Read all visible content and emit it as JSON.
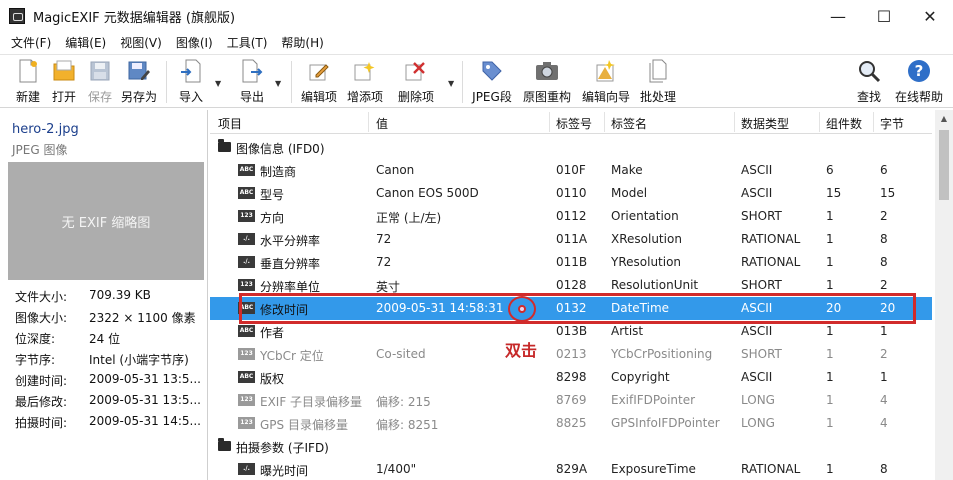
{
  "window": {
    "title": "MagicEXIF 元数据编辑器 (旗舰版)",
    "controls": [
      "—",
      "☐",
      "✕"
    ]
  },
  "menu": [
    "文件(F)",
    "编辑(E)",
    "视图(V)",
    "图像(I)",
    "工具(T)",
    "帮助(H)"
  ],
  "toolbar": {
    "new": "新建",
    "open": "打开",
    "save": "保存",
    "save_as": "另存为",
    "import": "导入",
    "export": "导出",
    "edit_item": "编辑项",
    "add_item": "增添项",
    "delete_item": "删除项",
    "jpeg_segment": "JPEG段",
    "rebuild": "原图重构",
    "wizard": "编辑向导",
    "batch": "批处理",
    "find": "查找",
    "help": "在线帮助"
  },
  "file": {
    "name": "hero-2.jpg",
    "type": "JPEG 图像",
    "thumb_text": "无 EXIF 缩略图",
    "info": [
      {
        "label": "文件大小:",
        "value": "709.39 KB"
      },
      {
        "label": "图像大小:",
        "value": "2322 × 1100 像素"
      },
      {
        "label": "位深度:",
        "value": "24 位"
      },
      {
        "label": "字节序:",
        "value": "Intel (小端字节序)"
      },
      {
        "label": "创建时间:",
        "value": "2009-05-31 13:5..."
      },
      {
        "label": "最后修改:",
        "value": "2009-05-31 13:5..."
      },
      {
        "label": "拍摄时间:",
        "value": "2009-05-31 14:5..."
      }
    ]
  },
  "table": {
    "headers": [
      "项目",
      "值",
      "标签号",
      "标签名",
      "数据类型",
      "组件数",
      "字节"
    ],
    "groups": [
      {
        "title": "图像信息 (IFD0)",
        "rows": [
          {
            "icon": "ABC",
            "name": "制造商",
            "value": "Canon",
            "tag": "010F",
            "tagname": "Make",
            "type": "ASCII",
            "count": "6",
            "bytes": "6"
          },
          {
            "icon": "ABC",
            "name": "型号",
            "value": "Canon EOS 500D",
            "tag": "0110",
            "tagname": "Model",
            "type": "ASCII",
            "count": "15",
            "bytes": "15"
          },
          {
            "icon": "123",
            "name": "方向",
            "value": "正常 (上/左)",
            "tag": "0112",
            "tagname": "Orientation",
            "type": "SHORT",
            "count": "1",
            "bytes": "2"
          },
          {
            "icon": "./.",
            "name": "水平分辨率",
            "value": "72",
            "tag": "011A",
            "tagname": "XResolution",
            "type": "RATIONAL",
            "count": "1",
            "bytes": "8"
          },
          {
            "icon": "./.",
            "name": "垂直分辨率",
            "value": "72",
            "tag": "011B",
            "tagname": "YResolution",
            "type": "RATIONAL",
            "count": "1",
            "bytes": "8"
          },
          {
            "icon": "123",
            "name": "分辨率单位",
            "value": "英寸",
            "tag": "0128",
            "tagname": "ResolutionUnit",
            "type": "SHORT",
            "count": "1",
            "bytes": "2"
          },
          {
            "icon": "ABC",
            "name": "修改时间",
            "value": "2009-05-31 14:58:31",
            "tag": "0132",
            "tagname": "DateTime",
            "type": "ASCII",
            "count": "20",
            "bytes": "20",
            "selected": true
          },
          {
            "icon": "ABC",
            "name": "作者",
            "value": "",
            "tag": "013B",
            "tagname": "Artist",
            "type": "ASCII",
            "count": "1",
            "bytes": "1"
          },
          {
            "icon": "123",
            "name": "YCbCr 定位",
            "value": "Co-sited",
            "tag": "0213",
            "tagname": "YCbCrPositioning",
            "type": "SHORT",
            "count": "1",
            "bytes": "2",
            "dim": true
          },
          {
            "icon": "ABC",
            "name": "版权",
            "value": "",
            "tag": "8298",
            "tagname": "Copyright",
            "type": "ASCII",
            "count": "1",
            "bytes": "1"
          },
          {
            "icon": "123",
            "name": "EXIF 子目录偏移量",
            "value": "偏移: 215",
            "tag": "8769",
            "tagname": "ExifIFDPointer",
            "type": "LONG",
            "count": "1",
            "bytes": "4",
            "dim": true
          },
          {
            "icon": "123",
            "name": "GPS 目录偏移量",
            "value": "偏移: 8251",
            "tag": "8825",
            "tagname": "GPSInfoIFDPointer",
            "type": "LONG",
            "count": "1",
            "bytes": "4",
            "dim": true
          }
        ]
      },
      {
        "title": "拍摄参数 (子IFD)",
        "rows": [
          {
            "icon": "./.",
            "name": "曝光时间",
            "value": "1/400\"",
            "tag": "829A",
            "tagname": "ExposureTime",
            "type": "RATIONAL",
            "count": "1",
            "bytes": "8"
          }
        ]
      }
    ]
  },
  "annotation": {
    "text": "双击",
    "color": "#d12b2b"
  },
  "colors": {
    "selection": "#3399ea",
    "accent": "#1c3f8c"
  }
}
